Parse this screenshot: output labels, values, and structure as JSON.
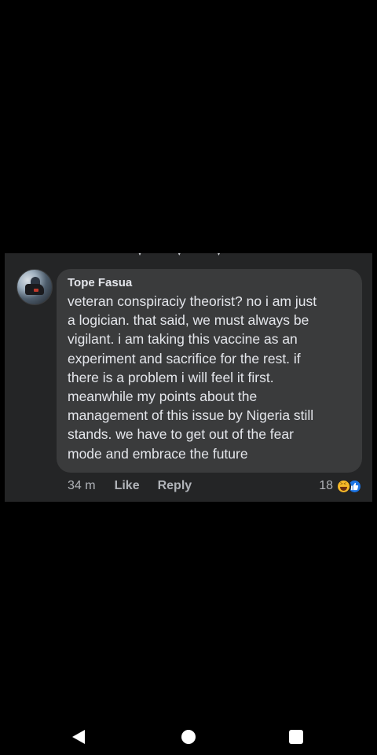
{
  "comment": {
    "author": "Tope Fasua",
    "text": "veteran conspiraciy theorist? no i am just\na logician. that said, we must always be\nvigilant. i am taking this vaccine as an\nexperiment and sacrifice for the rest. if\nthere is a problem i will feel it first.\nmeanwhile my points about the\nmanagement of this issue by Nigeria still\nstands. we have to get out of the fear\nmode and embrace the future",
    "timestamp": "34 m",
    "like_label": "Like",
    "reply_label": "Reply",
    "reaction_count": "18",
    "reaction_icons": [
      "haha-icon",
      "like-icon"
    ]
  },
  "navbar": {
    "icons": [
      "back-icon",
      "home-icon",
      "recents-icon"
    ]
  },
  "colors": {
    "background": "#000000",
    "panel": "#242526",
    "bubble": "#3a3b3c",
    "text": "#e4e6eb",
    "secondary_text": "#b0b3b8",
    "like_blue": "#1b74e4",
    "haha_yellow": "#f7b928"
  }
}
